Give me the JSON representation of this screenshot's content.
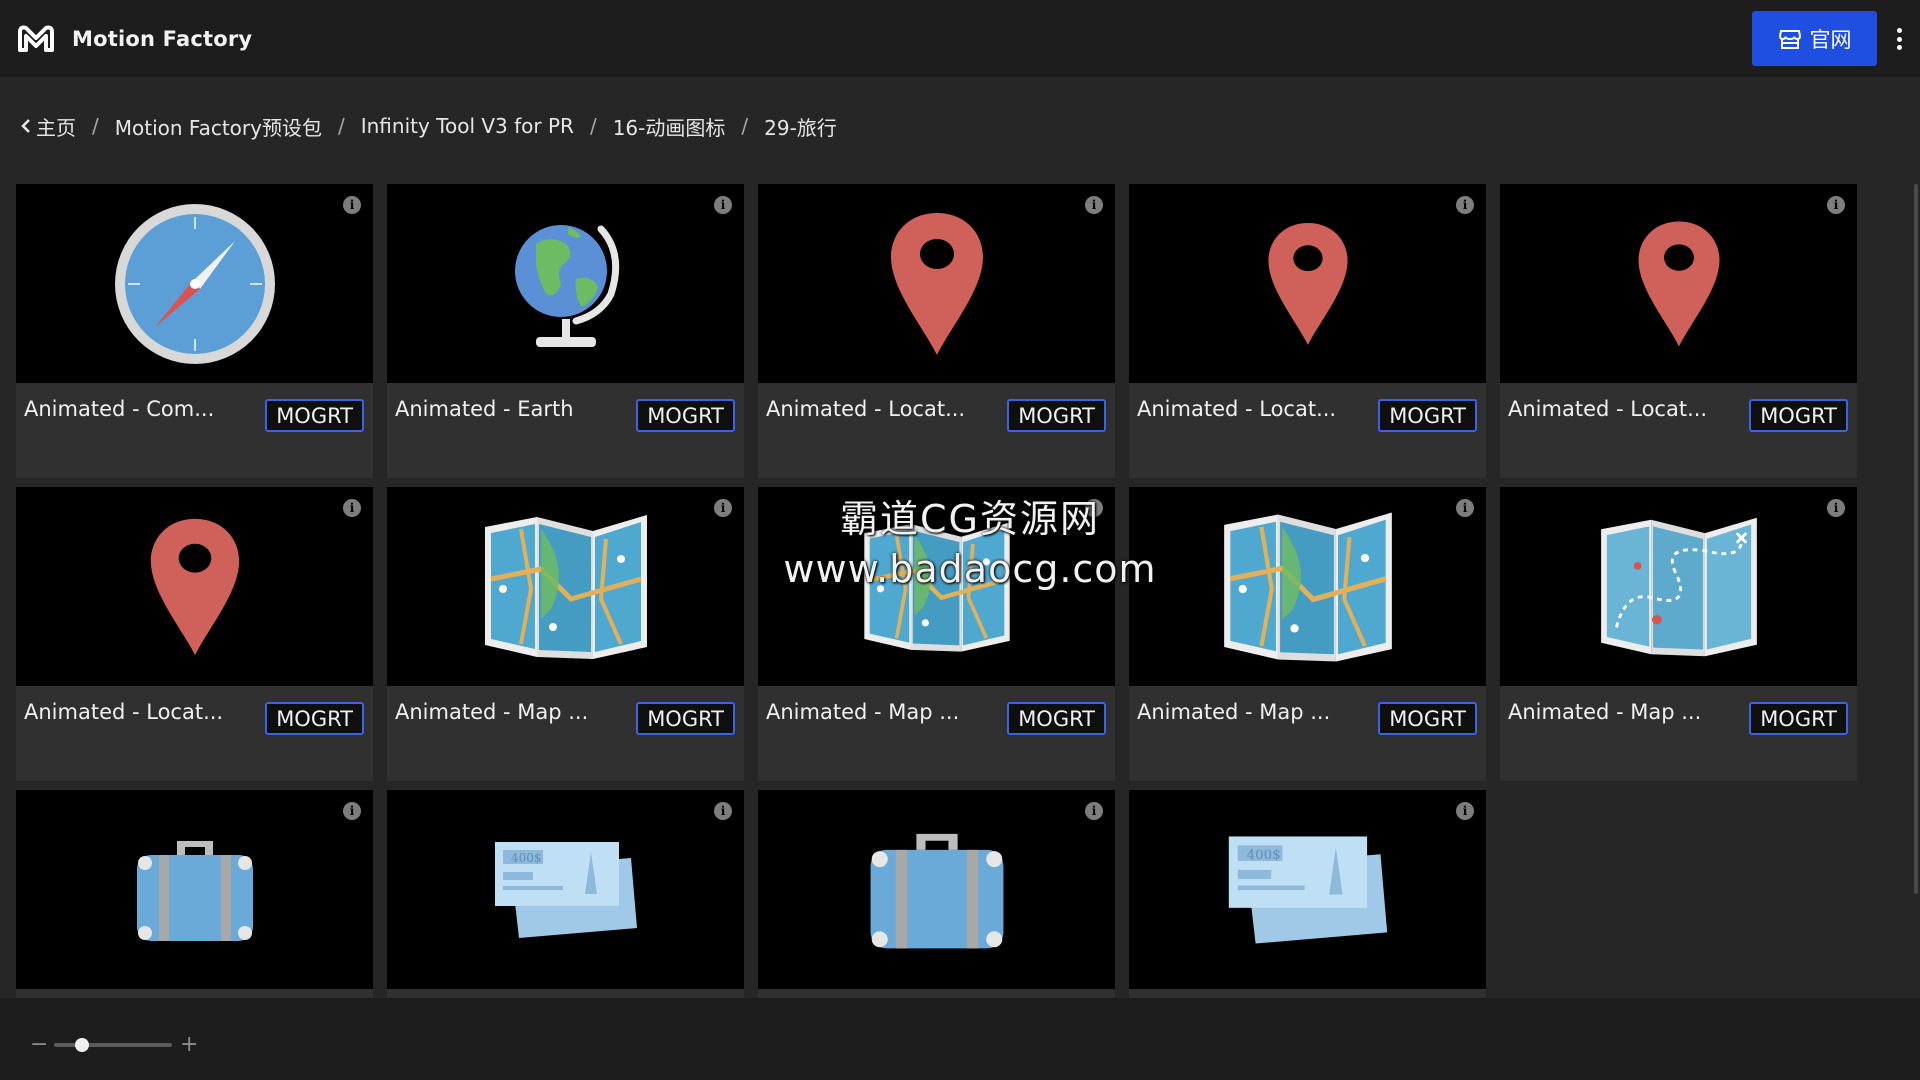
{
  "header": {
    "app_title": "Motion Factory",
    "official_label": "官网"
  },
  "breadcrumb": {
    "items": [
      "主页",
      "Motion Factory预设包",
      "Infinity Tool V3 for PR",
      "16-动画图标",
      "29-旅行"
    ]
  },
  "cards": [
    {
      "name": "Animated - Com...",
      "badge": "MOGRT",
      "icon": "compass-icon"
    },
    {
      "name": "Animated - Earth",
      "badge": "MOGRT",
      "icon": "globe-icon"
    },
    {
      "name": "Animated - Locat...",
      "badge": "MOGRT",
      "icon": "location-pin-icon"
    },
    {
      "name": "Animated - Locat...",
      "badge": "MOGRT",
      "icon": "location-pin-icon"
    },
    {
      "name": "Animated - Locat...",
      "badge": "MOGRT",
      "icon": "location-pin-icon"
    },
    {
      "name": "Animated - Locat...",
      "badge": "MOGRT",
      "icon": "location-pin-icon"
    },
    {
      "name": "Animated - Map ...",
      "badge": "MOGRT",
      "icon": "map-icon"
    },
    {
      "name": "Animated - Map ...",
      "badge": "MOGRT",
      "icon": "map-icon"
    },
    {
      "name": "Animated - Map ...",
      "badge": "MOGRT",
      "icon": "map-icon"
    },
    {
      "name": "Animated - Map ...",
      "badge": "MOGRT",
      "icon": "treasure-map-icon"
    },
    {
      "name": "",
      "badge": "",
      "icon": "suitcase-icon"
    },
    {
      "name": "",
      "badge": "",
      "icon": "ticket-icon",
      "ticket_price": "400$"
    },
    {
      "name": "",
      "badge": "",
      "icon": "suitcase-icon"
    },
    {
      "name": "",
      "badge": "",
      "icon": "ticket-icon",
      "ticket_price": "400$"
    }
  ],
  "watermark": {
    "line1": "霸道CG资源网",
    "line2": "www.badaocg.com"
  },
  "zoom": {
    "minus": "−",
    "plus": "+",
    "level_fraction": 0.2
  },
  "colors": {
    "accent_blue": "#1f4fe0",
    "pin_red": "#d0605a",
    "map_blue": "#4fa8cf",
    "suitcase_blue": "#6aaad8"
  }
}
